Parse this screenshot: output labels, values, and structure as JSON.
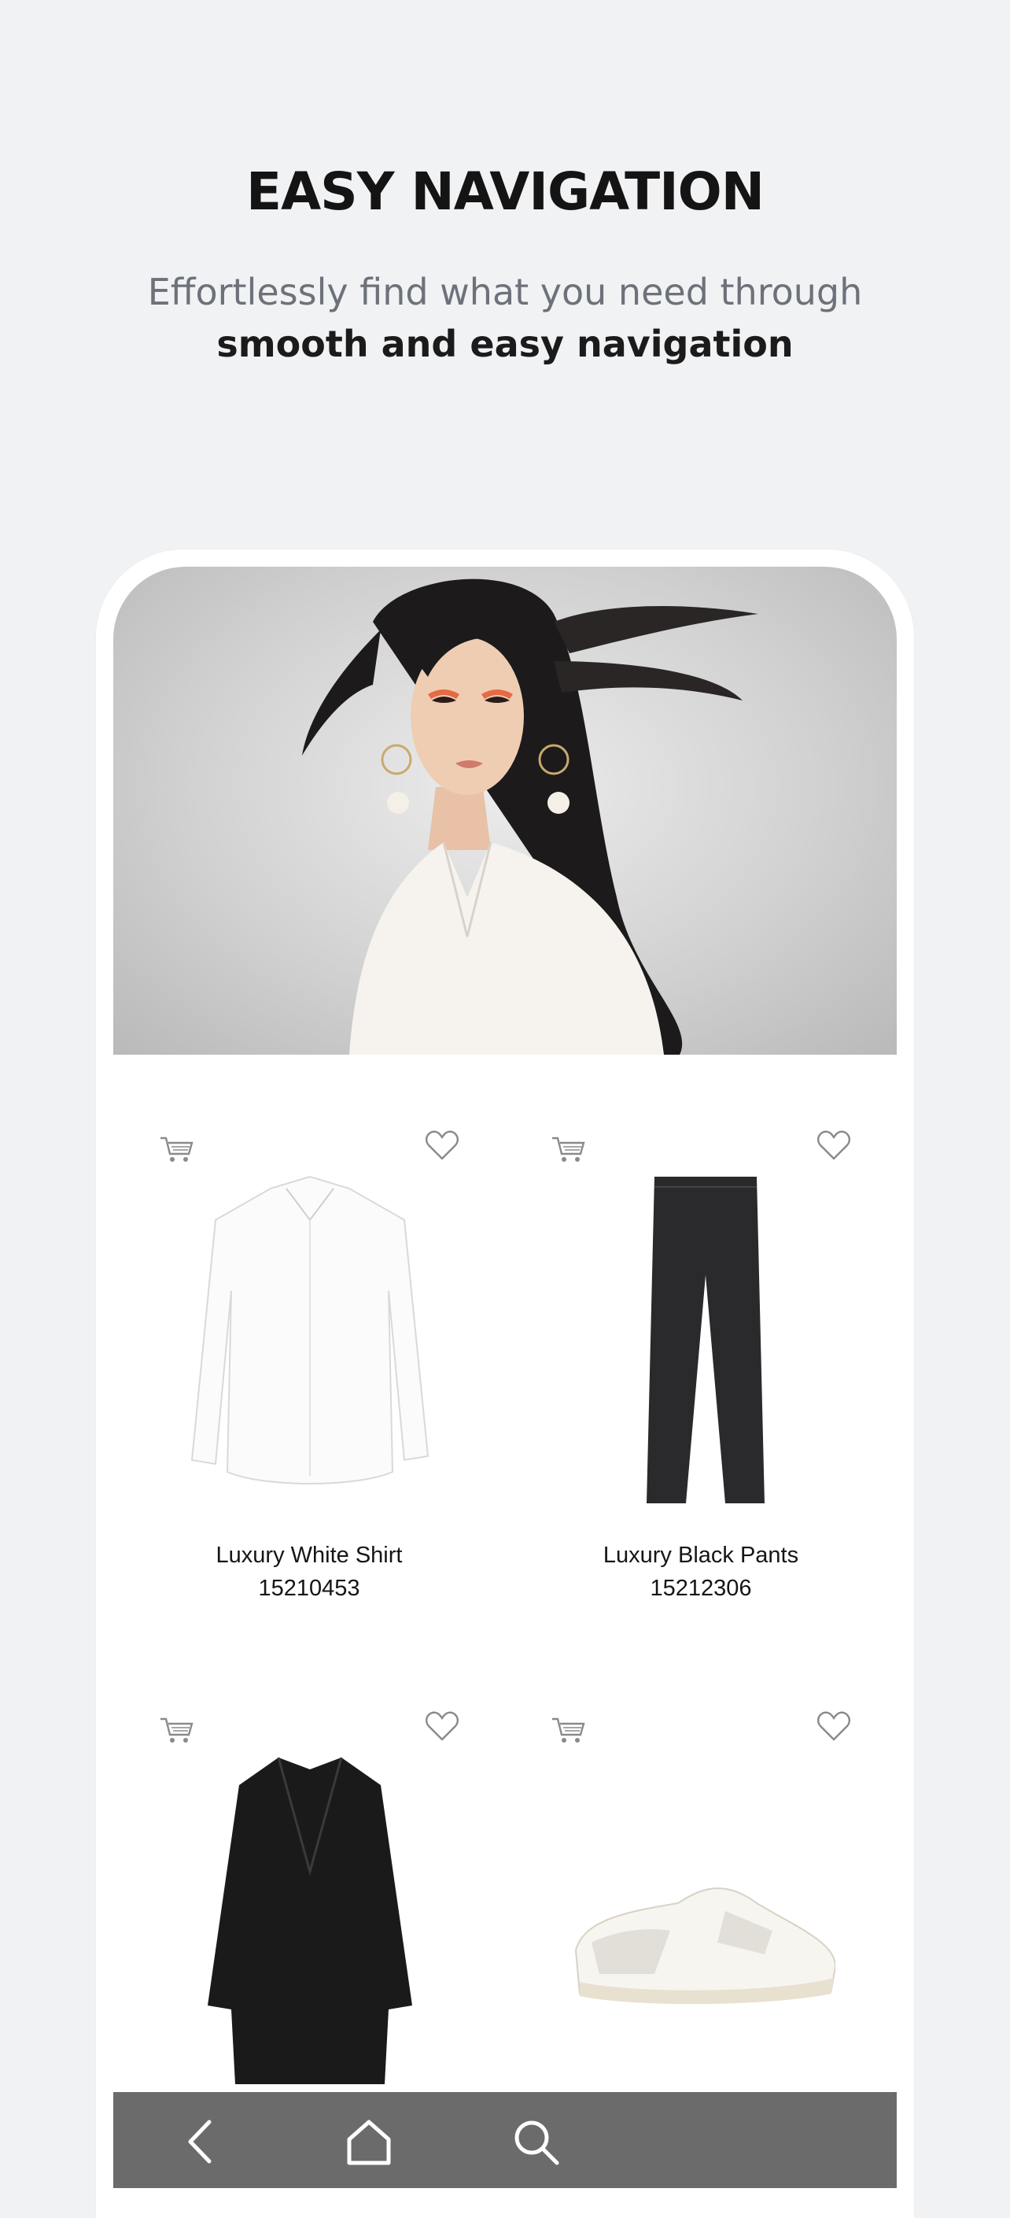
{
  "promo": {
    "title": "EASY NAVIGATION",
    "subtitle_line1": "Effortlessly find what you need through",
    "subtitle_line2": "smooth and easy navigation"
  },
  "products": [
    {
      "name": "Luxury White Shirt",
      "code": "15210453",
      "image": "white-shirt"
    },
    {
      "name": "Luxury Black Pants",
      "code": "15212306",
      "image": "black-pants"
    },
    {
      "name": "",
      "code": "",
      "image": "black-coat"
    },
    {
      "name": "",
      "code": "",
      "image": "white-sneaker"
    }
  ],
  "icons": {
    "cart": "shopping-cart-icon",
    "wishlist": "heart-icon",
    "back": "chevron-left-icon",
    "home": "home-icon",
    "search": "search-icon"
  },
  "colors": {
    "background": "#f1f2f4",
    "nav_bar": "#6b6b6b",
    "title": "#141414",
    "subtitle": "#6d727a"
  }
}
